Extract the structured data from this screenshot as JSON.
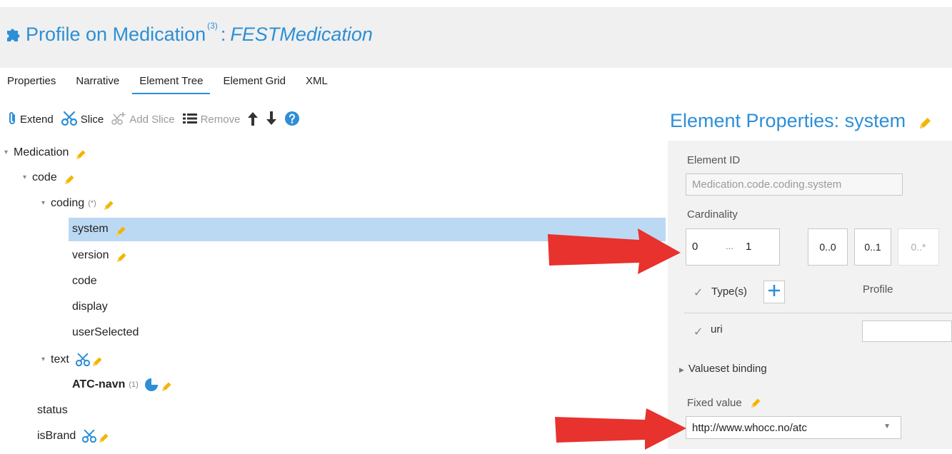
{
  "header": {
    "title": "Profile on Medication",
    "superscript": "(3)",
    "separator": ":",
    "profile_name": "FESTMedication"
  },
  "tabs": [
    {
      "label": "Properties",
      "active": false
    },
    {
      "label": "Narrative",
      "active": false
    },
    {
      "label": "Element Tree",
      "active": true
    },
    {
      "label": "Element Grid",
      "active": false
    },
    {
      "label": "XML",
      "active": false
    }
  ],
  "toolbar": {
    "extend": "Extend",
    "slice": "Slice",
    "add_slice": "Add Slice",
    "remove": "Remove"
  },
  "tree": {
    "medication": "Medication",
    "code": "code",
    "coding": "coding",
    "coding_card": "(*)",
    "system": "system",
    "version": "version",
    "code2": "code",
    "display": "display",
    "userSelected": "userSelected",
    "text": "text",
    "atc_navn": "ATC-navn",
    "atc_card": "(1)",
    "status": "status",
    "isBrand": "isBrand"
  },
  "panel": {
    "title": "Element Properties: system",
    "element_id_label": "Element ID",
    "element_id_value": "Medication.code.coding.system",
    "cardinality_label": "Cardinality",
    "card_min": "0",
    "card_dots": "...",
    "card_max": "1",
    "preset_00": "0..0",
    "preset_01": "0..1",
    "preset_0star": "0..*",
    "types_label": "Type(s)",
    "profile_label": "Profile",
    "type_uri": "uri",
    "valueset_binding": "Valueset binding",
    "fixed_value_label": "Fixed value",
    "fixed_value": "http://www.whocc.no/atc"
  },
  "colors": {
    "accent": "#2d8fd6",
    "selection": "#bcd9f3",
    "pencil": "#f5b400",
    "arrow": "#e8322e"
  }
}
